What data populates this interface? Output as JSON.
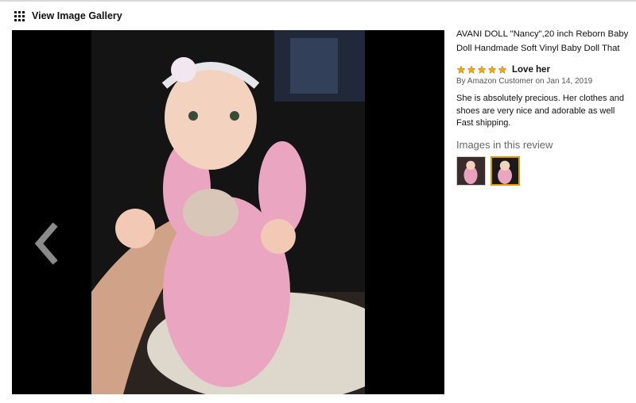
{
  "header": {
    "label": "View Image Gallery",
    "icon": "grid-icon"
  },
  "viewer": {
    "prev_icon": "chevron-left-icon"
  },
  "product": {
    "title": "AVANI DOLL \"Nancy\",20 inch Reborn Baby Doll Handmade Soft Vinyl Baby Doll That"
  },
  "review": {
    "stars": 5,
    "star_color": "#f0a81a",
    "title": "Love her",
    "byline": "By Amazon Customer on Jan 14, 2019",
    "body": "She is absolutely precious. Her clothes and shoes are very nice and adorable as well Fast shipping."
  },
  "images_section": {
    "heading": "Images in this review",
    "thumbnails": [
      {
        "name": "review-image-1",
        "selected": false
      },
      {
        "name": "review-image-2",
        "selected": true
      }
    ],
    "selected_border": "#e59900"
  }
}
